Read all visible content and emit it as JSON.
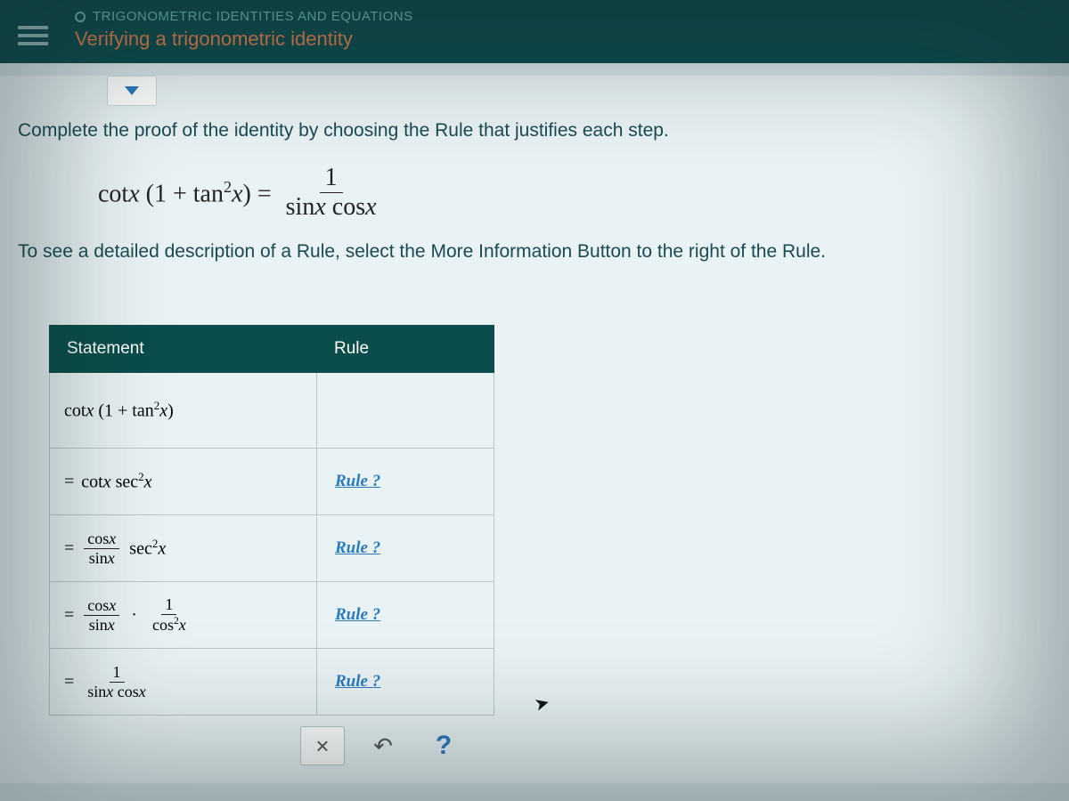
{
  "header": {
    "breadcrumb": "TRIGONOMETRIC IDENTITIES AND EQUATIONS",
    "title": "Verifying a trigonometric identity"
  },
  "instructions": {
    "line1": "Complete the proof of the identity by choosing the Rule that justifies each step.",
    "line2": "To see a detailed description of a Rule, select the More Information Button to the right of the Rule."
  },
  "identity": {
    "lhs_a": "cot",
    "lhs_var": "x",
    "lhs_paren": "(1 + tan",
    "lhs_exp": "2",
    "lhs_close": "x) =",
    "rhs_num": "1",
    "rhs_den": "sinx cosx"
  },
  "table": {
    "col_statement": "Statement",
    "col_rule": "Rule",
    "rule_placeholder": "Rule ?"
  },
  "rows": {
    "r0": {
      "eq": "",
      "a": "cot",
      "var": "x",
      "rest": "(1 + tan",
      "exp": "2",
      "close": "x)"
    },
    "r1": {
      "eq": "=",
      "a": "cot",
      "var": "x",
      "b": " sec",
      "exp": "2",
      "close": "x"
    },
    "r2": {
      "eq": "=",
      "num": "cosx",
      "den": "sinx",
      "mult": "sec",
      "exp": "2",
      "close": "x"
    },
    "r3": {
      "eq": "=",
      "numA": "cosx",
      "denA": "sinx",
      "dot": "·",
      "numB": "1",
      "denB_a": "cos",
      "denB_exp": "2",
      "denB_b": "x"
    },
    "r4": {
      "eq": "=",
      "num": "1",
      "den": "sinx cosx"
    }
  },
  "actions": {
    "clear": "×",
    "undo": "↶",
    "help": "?"
  }
}
